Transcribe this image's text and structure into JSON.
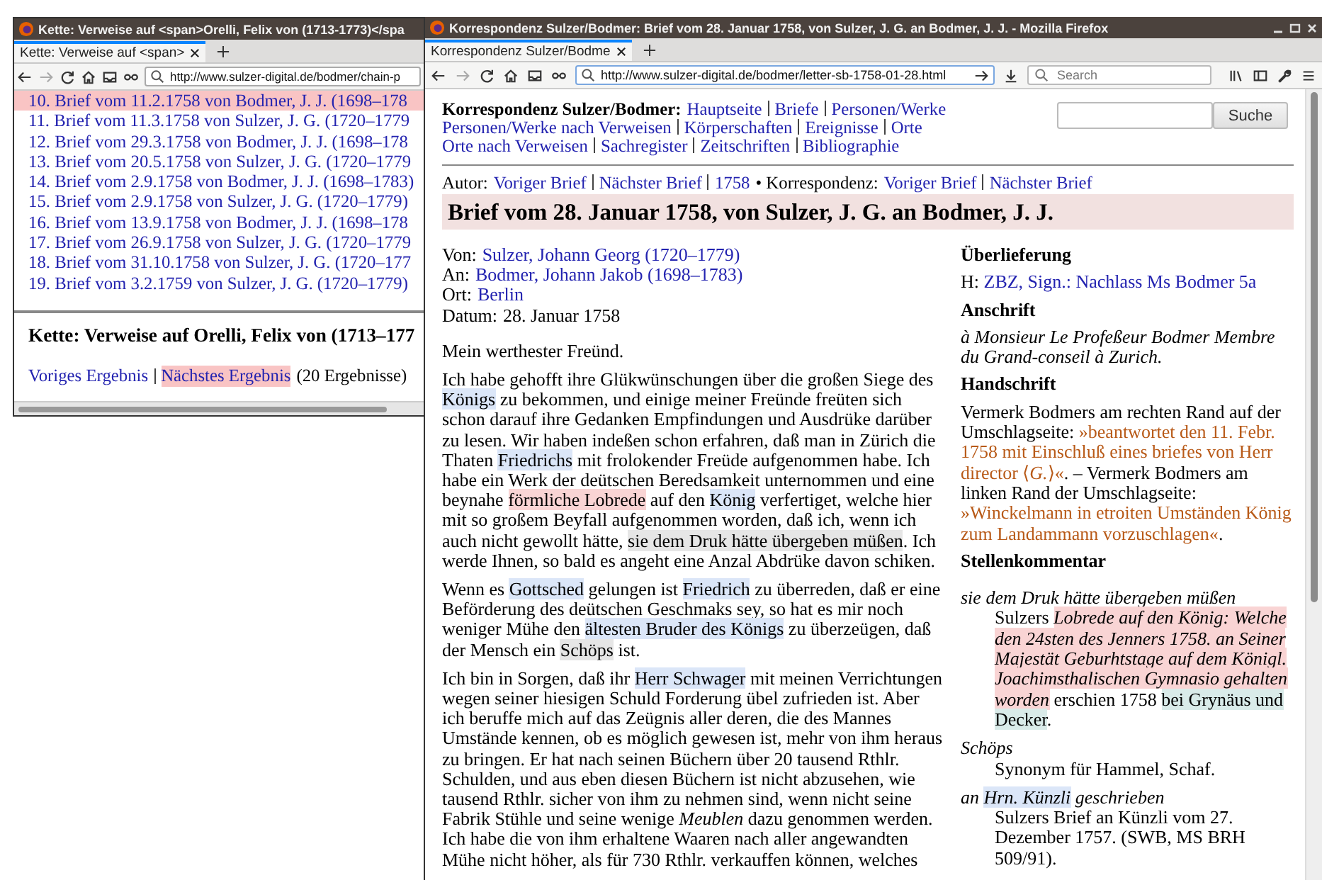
{
  "back": {
    "title": "Kette: Verweise auf <span>Orelli, Felix von (1713-1773)</spa",
    "tabs": [
      {
        "label": "Kette: Verweise auf <span>",
        "selected": true
      }
    ],
    "url": "http://www.sulzer-digital.de/bodmer/chain-p",
    "results": [
      {
        "label": "10. Brief vom 11.2.1758 von Bodmer, J. J. (1698–178",
        "selected": true
      },
      {
        "label": "11. Brief vom 11.3.1758 von Sulzer, J. G. (1720–1779",
        "selected": false
      },
      {
        "label": "12. Brief vom 29.3.1758 von Bodmer, J. J. (1698–178",
        "selected": false
      },
      {
        "label": "13. Brief vom 20.5.1758 von Sulzer, J. G. (1720–1779",
        "selected": false
      },
      {
        "label": "14. Brief vom 2.9.1758 von Bodmer, J. J. (1698–1783)",
        "selected": false
      },
      {
        "label": "15. Brief vom 2.9.1758 von Sulzer, J. G. (1720–1779)",
        "selected": false
      },
      {
        "label": "16. Brief vom 13.9.1758 von Bodmer, J. J. (1698–178",
        "selected": false
      },
      {
        "label": "17. Brief vom 26.9.1758 von Sulzer, J. G. (1720–1779",
        "selected": false
      },
      {
        "label": "18. Brief vom 31.10.1758 von Sulzer, J. G. (1720–177",
        "selected": false
      },
      {
        "label": "19. Brief vom 3.2.1759 von Sulzer, J. G. (1720–1779)",
        "selected": false
      }
    ],
    "heading": "Kette: Verweise auf Orelli, Felix von (1713–177",
    "pager": {
      "links": [
        {
          "label": "Voriges Ergebnis",
          "highlighted": false
        },
        {
          "label": "Nächstes Ergebnis",
          "highlighted": true
        }
      ],
      "count": "(20 Ergebnisse)"
    }
  },
  "front": {
    "title": "Korrespondenz Sulzer/Bodmer: Brief vom 28. Januar 1758, von Sulzer, J. G. an Bodmer, J. J. - Mozilla Firefox",
    "tabs": [
      {
        "label": "Korrespondenz Sulzer/Bodme",
        "selected": true
      }
    ],
    "url": "http://www.sulzer-digital.de/bodmer/letter-sb-1758-01-28.html",
    "search": {
      "placeholder": "Search"
    },
    "site_nav": {
      "label": "Korrespondenz Sulzer/Bodmer:",
      "rows": [
        [
          "Hauptseite",
          "Briefe",
          "Personen/Werke"
        ],
        [
          "Personen/Werke nach Verweisen",
          "Körperschaften",
          "Ereignisse",
          "Orte"
        ],
        [
          "Orte nach Verweisen",
          "Sachregister",
          "Zeitschriften",
          "Bibliographie"
        ]
      ]
    },
    "site_search": {
      "button": "Suche"
    },
    "letter_nav": [
      {
        "label": "Autor:",
        "links": [
          "Voriger Brief",
          "Nächster Brief",
          "1758"
        ]
      },
      {
        "label": "• Korrespondenz:",
        "links": [
          "Voriger Brief",
          "Nächster Brief"
        ]
      }
    ],
    "letter_title": "Brief vom 28. Januar 1758, von Sulzer, J. G. an Bodmer, J. J.",
    "meta": [
      {
        "label": "Von:",
        "value": "Sulzer, Johann Georg (1720–1779)",
        "kind": "link"
      },
      {
        "label": "An:",
        "value": "Bodmer, Johann Jakob (1698–1783)",
        "kind": "link"
      },
      {
        "label": "Ort:",
        "value": "Berlin",
        "kind": "link"
      },
      {
        "label": "Datum:",
        "value": "28. Januar 1758",
        "kind": "text"
      }
    ],
    "salutation": "Mein werthester Freünd.",
    "paragraphs": [
      [
        {
          "kind": "plain",
          "text": "Ich habe gehofft ihre Glükwünschungen über die großen Siege des "
        },
        {
          "kind": "person",
          "text": "Königs"
        },
        {
          "kind": "plain",
          "text": " zu bekommen, und einige meiner Freünde freüten sich schon darauf ihre Gedanken Empfindungen und Ausdrüke darüber zu lesen. Wir haben indeßen schon erfahren, daß man in Zürich die Thaten "
        },
        {
          "kind": "person",
          "text": "Friedrichs"
        },
        {
          "kind": "plain",
          "text": " mit frolokender Freüde aufgenommen habe. Ich habe ein Werk der deütschen Beredsamkeit unternommen und eine beynahe "
        },
        {
          "kind": "work",
          "text": "förmliche Lobrede"
        },
        {
          "kind": "plain",
          "text": " auf den "
        },
        {
          "kind": "person",
          "text": "König"
        },
        {
          "kind": "plain",
          "text": " verfertiget, welche hier mit so großem Beyfall aufgenommen worden, daß ich, wenn ich auch nicht gewollt hätte, "
        },
        {
          "kind": "comment",
          "text": "sie dem Druk hätte übergeben müßen"
        },
        {
          "kind": "plain",
          "text": ". Ich werde Ihnen, so bald es angeht eine Anzal Abdrüke davon schiken."
        }
      ],
      [
        {
          "kind": "plain",
          "text": "Wenn es "
        },
        {
          "kind": "person",
          "text": "Gottsched"
        },
        {
          "kind": "plain",
          "text": " gelungen ist "
        },
        {
          "kind": "person",
          "text": "Friedrich"
        },
        {
          "kind": "plain",
          "text": " zu überreden, daß er eine Beförderung des deütschen Geschmaks sey, so hat es mir noch weniger Mühe den "
        },
        {
          "kind": "person",
          "text": "ältesten Bruder des Königs"
        },
        {
          "kind": "plain",
          "text": " zu überzeügen, daß der Mensch ein "
        },
        {
          "kind": "comment",
          "text": "Schöps"
        },
        {
          "kind": "plain",
          "text": " ist."
        }
      ],
      [
        {
          "kind": "plain",
          "text": "Ich bin in Sorgen, daß ihr "
        },
        {
          "kind": "person",
          "text": "Herr Schwager"
        },
        {
          "kind": "plain",
          "text": " mit meinen Verrichtungen wegen seiner hiesigen Schuld Forderung übel zufrieden ist. Aber ich beruffe mich auf das Zeügnis aller deren, die des Mannes Umstände kennen, ob es möglich gewesen ist, mehr von ihm heraus zu bringen. Er hat nach seinen Büchern über 20 tausend Rthlr. Schulden, und aus eben diesen Büchern ist nicht abzusehen, wie tausend Rthlr. sicher von ihm zu nehmen sind, wenn nicht seine Fabrik Stühle und seine wenige *Meublen* dazu genommen werden. Ich habe die von ihm erhaltene Waaren nach aller angewandten Mühe nicht höher, als für 730 Rthlr. verkauffen können, welches"
        }
      ]
    ],
    "sections": [
      {
        "heading": "Überlieferung",
        "paragraph": [
          {
            "kind": "plain",
            "text": "H: "
          },
          {
            "kind": "link",
            "text": "ZBZ, Sign.: Nachlass Ms Bodmer 5a"
          }
        ]
      },
      {
        "heading": "Anschrift",
        "paragraph": [
          {
            "kind": "emph",
            "text": "à Monsieur Le Profeßeur Bodmer Membre du Grand-conseil à Zurich."
          }
        ]
      },
      {
        "heading": "Handschrift",
        "paragraph": [
          {
            "kind": "plain",
            "text": "Vermerk Bodmers am rechten Rand auf der Umschlagseite: "
          },
          {
            "kind": "quote",
            "text": "»beantwortet den 11. Febr. 1758 mit Einschluß eines briefes von Herr director ⟨*G.*⟩«"
          },
          {
            "kind": "plain",
            "text": ". – Vermerk Bodmers am linken Rand der Umschlagseite: "
          },
          {
            "kind": "quote",
            "text": "»Winckelmann in etroiten Umständen König zum Landammann vorzuschlagen«"
          },
          {
            "kind": "plain",
            "text": "."
          }
        ]
      }
    ],
    "commentary": {
      "heading": "Stellenkommentar",
      "entries": [
        {
          "lemma": [
            {
              "kind": "plain",
              "text": "sie dem Druk hätte übergeben müßen"
            }
          ],
          "note": [
            {
              "kind": "plain",
              "text": "Sulzers "
            },
            {
              "kind": "worktitle",
              "text": "Lobrede auf den König: Welche den 24sten des Jenners 1758. an Seiner Majestät Geburhtstage auf dem Königl. Joachimsthalischen Gymnasio gehalten worden"
            },
            {
              "kind": "plain",
              "text": " erschien 1758 "
            },
            {
              "kind": "place",
              "text": "bei Grynäus und Decker"
            },
            {
              "kind": "plain",
              "text": "."
            }
          ]
        },
        {
          "lemma": [
            {
              "kind": "plain",
              "text": "Schöps"
            }
          ],
          "note": [
            {
              "kind": "plain",
              "text": "Synonym für Hammel, Schaf."
            }
          ]
        },
        {
          "lemma": [
            {
              "kind": "plain",
              "text": "an "
            },
            {
              "kind": "person",
              "text": "Hrn. Künzli"
            },
            {
              "kind": "plain",
              "text": " geschrieben"
            }
          ],
          "note": [
            {
              "kind": "plain",
              "text": "Sulzers Brief an Künzli vom 27. Dezember 1757. (SWB, MS BRH 509/91)."
            }
          ]
        }
      ]
    }
  }
}
